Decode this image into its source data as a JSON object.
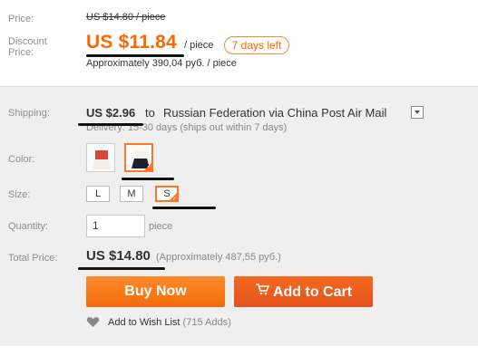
{
  "labels": {
    "price": "Price:",
    "discount_line1": "Discount",
    "discount_line2": "Price:",
    "shipping": "Shipping:",
    "color": "Color:",
    "size": "Size:",
    "quantity": "Quantity:",
    "total_price": "Total Price:"
  },
  "price": {
    "original": "US $14.80 / piece",
    "discount": "US $11.84",
    "per_piece": "/ piece",
    "days_left": "7 days left",
    "approx": "Approximately 390,04 руб. / piece"
  },
  "shipping": {
    "price": "US $2.96",
    "to": "to",
    "destination": "Russian Federation via China Post Air Mail",
    "delivery": "Delivery: 15-30 days (ships out within 7 days)"
  },
  "sizes": [
    "L",
    "M",
    "S"
  ],
  "selected_size": "S",
  "quantity": {
    "value": "1",
    "unit": "piece"
  },
  "total": {
    "price": "US $14.80",
    "approx": "(Approximately 487,55 руб.)"
  },
  "buttons": {
    "buy_now": "Buy Now",
    "add_to_cart": "Add to Cart"
  },
  "wishlist": {
    "label": "Add to Wish List",
    "count": "(715 Adds)"
  },
  "colors": {
    "accent": "#ff6600",
    "panel": "#efefef"
  },
  "icons": [
    "dropdown-icon",
    "cart-icon",
    "heart-icon",
    "checkmark-icon"
  ]
}
